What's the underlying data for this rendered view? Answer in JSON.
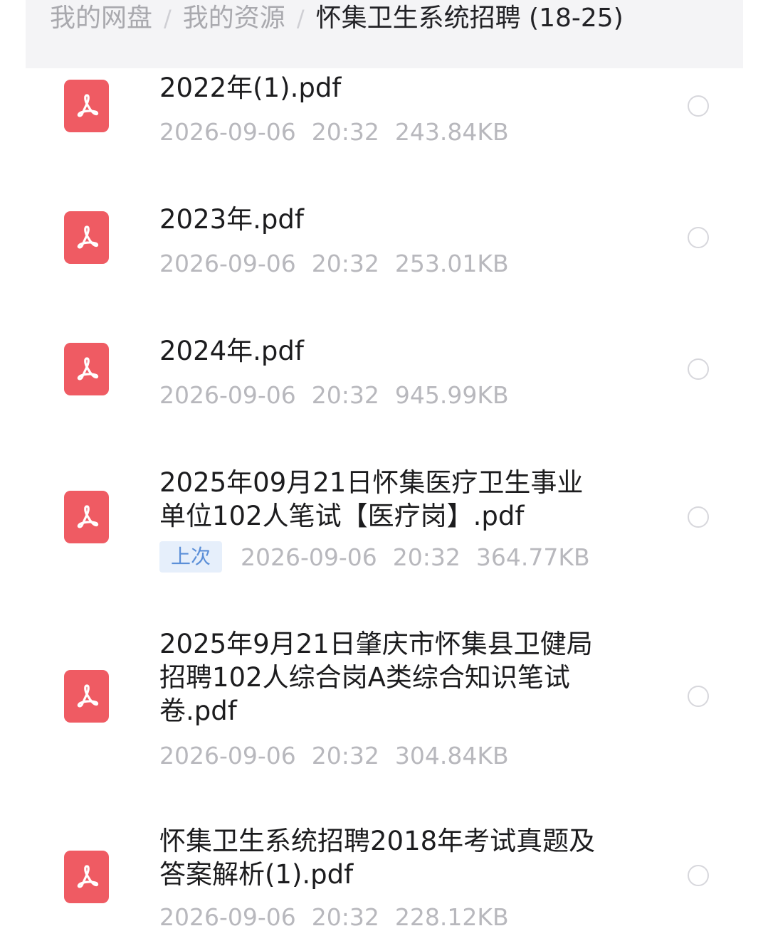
{
  "breadcrumb": {
    "items": [
      "我的网盘",
      "我的资源",
      "怀集卫生系统招聘 (18-25)"
    ],
    "separator": "/"
  },
  "files": [
    {
      "name": "2022年(1).pdf",
      "date": "2026-09-06",
      "time": "20:32",
      "size": "243.84KB",
      "badge": ""
    },
    {
      "name": "2023年.pdf",
      "date": "2026-09-06",
      "time": "20:32",
      "size": "253.01KB",
      "badge": ""
    },
    {
      "name": "2024年.pdf",
      "date": "2026-09-06",
      "time": "20:32",
      "size": "945.99KB",
      "badge": ""
    },
    {
      "name": "2025年09月21日怀集医疗卫生事业单位102人笔试【医疗岗】.pdf",
      "date": "2026-09-06",
      "time": "20:32",
      "size": "364.77KB",
      "badge": "上次"
    },
    {
      "name": "2025年9月21日肇庆市怀集县卫健局招聘102人综合岗A类综合知识笔试卷.pdf",
      "date": "2026-09-06",
      "time": "20:32",
      "size": "304.84KB",
      "badge": ""
    },
    {
      "name": "怀集卫生系统招聘2018年考试真题及答案解析(1).pdf",
      "date": "2026-09-06",
      "time": "20:32",
      "size": "228.12KB",
      "badge": ""
    }
  ],
  "icons": {
    "file": "pdf-file-icon",
    "select": "radio-circle-icon"
  },
  "colors": {
    "pdf_icon": "#ef5b63",
    "badge_bg": "#e6effb",
    "badge_text": "#5b8fd8"
  }
}
